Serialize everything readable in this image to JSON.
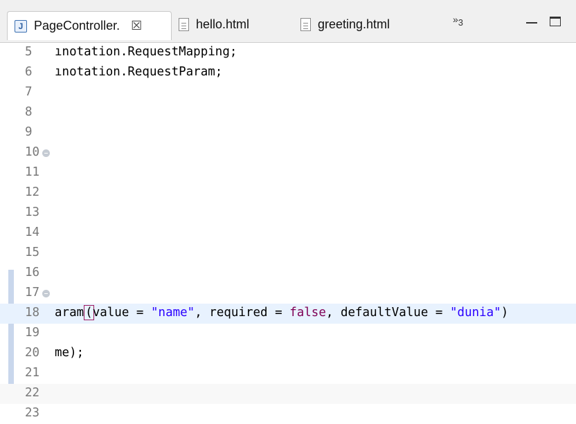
{
  "tabs": [
    {
      "label": "PageController.",
      "icon": "java-file-icon",
      "close": "☒"
    },
    {
      "label": "hello.html",
      "icon": "html-file-icon"
    },
    {
      "label": "greeting.html",
      "icon": "html-file-icon"
    }
  ],
  "overflow": {
    "chevron": "»",
    "count": "3"
  },
  "editor": {
    "lines": [
      {
        "n": "5",
        "code": "ınotation.RequestMapping;"
      },
      {
        "n": "6",
        "code": "ınotation.RequestParam;"
      },
      {
        "n": "7",
        "code": ""
      },
      {
        "n": "8",
        "code": ""
      },
      {
        "n": "9",
        "code": ""
      },
      {
        "n": "10",
        "code": "",
        "fold": true
      },
      {
        "n": "11",
        "code": ""
      },
      {
        "n": "12",
        "code": ""
      },
      {
        "n": "13",
        "code": ""
      },
      {
        "n": "14",
        "code": ""
      },
      {
        "n": "15",
        "code": ""
      },
      {
        "n": "16",
        "code": ""
      },
      {
        "n": "17",
        "code": "",
        "fold": true
      },
      {
        "n": "18",
        "parts": [
          "aram",
          "(",
          "value = ",
          "\"name\"",
          ", required = ",
          "false",
          ", defaultValue = ",
          "\"dunia\"",
          ")"
        ]
      },
      {
        "n": "19",
        "code": ""
      },
      {
        "n": "20",
        "code": "me);"
      },
      {
        "n": "21",
        "code": ""
      },
      {
        "n": "22",
        "code": ""
      },
      {
        "n": "23",
        "code": ""
      }
    ]
  }
}
